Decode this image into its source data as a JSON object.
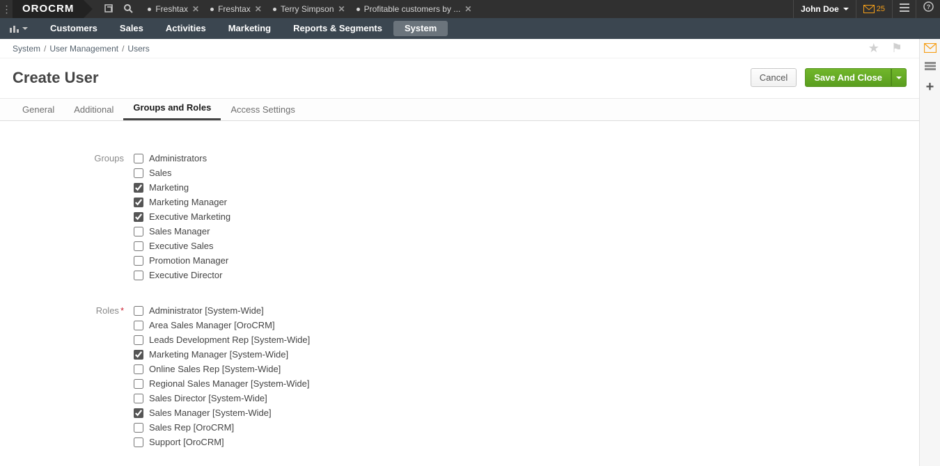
{
  "app": {
    "logo": "OROCRM"
  },
  "topIcons": {
    "newWindow": "↗",
    "search": "⌕"
  },
  "openTabs": [
    {
      "label": "Freshtax"
    },
    {
      "label": "Freshtax"
    },
    {
      "label": "Terry Simpson"
    },
    {
      "label": "Profitable customers by ..."
    }
  ],
  "currentUser": {
    "name": "John Doe"
  },
  "notifications": {
    "count": "25"
  },
  "mainNav": {
    "items": [
      "Customers",
      "Sales",
      "Activities",
      "Marketing",
      "Reports & Segments",
      "System"
    ],
    "activeIndex": 5
  },
  "breadcrumb": [
    "System",
    "User Management",
    "Users"
  ],
  "page": {
    "title": "Create User"
  },
  "actions": {
    "cancel": "Cancel",
    "save": "Save And Close"
  },
  "formTabs": [
    "General",
    "Additional",
    "Groups and Roles",
    "Access Settings"
  ],
  "formTabActive": 2,
  "sections": {
    "groups": {
      "label": "Groups",
      "required": false,
      "options": [
        {
          "label": "Administrators",
          "checked": false
        },
        {
          "label": "Sales",
          "checked": false
        },
        {
          "label": "Marketing",
          "checked": true
        },
        {
          "label": "Marketing Manager",
          "checked": true
        },
        {
          "label": "Executive Marketing",
          "checked": true
        },
        {
          "label": "Sales Manager",
          "checked": false
        },
        {
          "label": "Executive Sales",
          "checked": false
        },
        {
          "label": "Promotion Manager",
          "checked": false
        },
        {
          "label": "Executive Director",
          "checked": false
        }
      ]
    },
    "roles": {
      "label": "Roles",
      "required": true,
      "options": [
        {
          "label": "Administrator [System-Wide]",
          "checked": false
        },
        {
          "label": "Area Sales Manager [OroCRM]",
          "checked": false
        },
        {
          "label": "Leads Development Rep [System-Wide]",
          "checked": false
        },
        {
          "label": "Marketing Manager [System-Wide]",
          "checked": true
        },
        {
          "label": "Online Sales Rep [System-Wide]",
          "checked": false
        },
        {
          "label": "Regional Sales Manager [System-Wide]",
          "checked": false
        },
        {
          "label": "Sales Director [System-Wide]",
          "checked": false
        },
        {
          "label": "Sales Manager [System-Wide]",
          "checked": true
        },
        {
          "label": "Sales Rep [OroCRM]",
          "checked": false
        },
        {
          "label": "Support [OroCRM]",
          "checked": false
        }
      ]
    }
  }
}
